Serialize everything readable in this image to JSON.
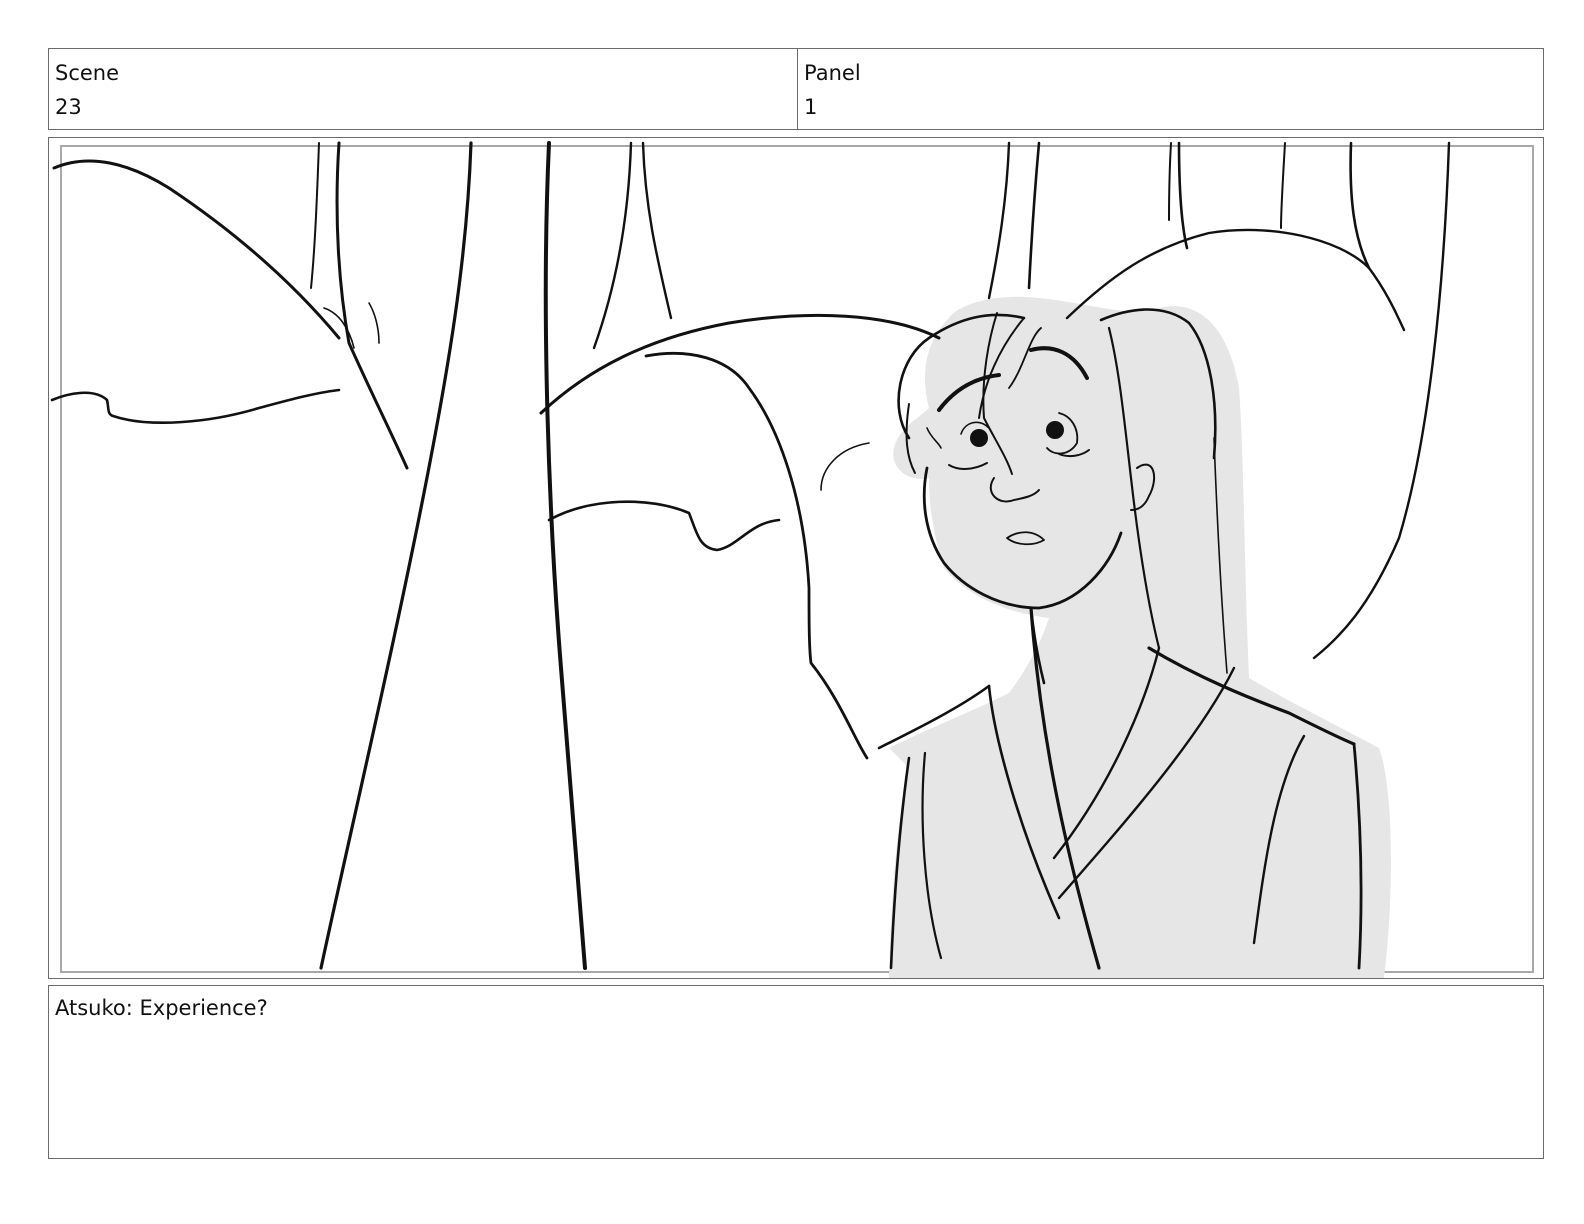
{
  "header": {
    "scene_label": "Scene",
    "scene_value": "23",
    "panel_label": "Panel",
    "panel_value": "1"
  },
  "artwork": {
    "description_name": "storyboard-sketch",
    "fill_color": "#e6e6e6",
    "line_color": "#111111",
    "safe_frame_color": "#a8a8a8"
  },
  "dialogue": {
    "text": "Atsuko: Experience?"
  }
}
